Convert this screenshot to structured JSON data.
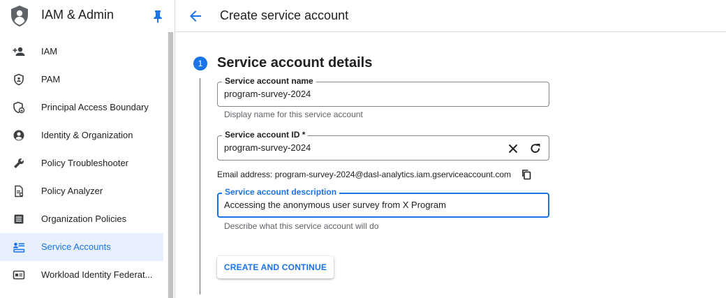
{
  "sidebar": {
    "product_title": "IAM & Admin",
    "items": [
      {
        "label": "IAM",
        "icon": "person-add-icon"
      },
      {
        "label": "PAM",
        "icon": "shield-icon"
      },
      {
        "label": "Principal Access Boundary",
        "icon": "boundary-shield-icon"
      },
      {
        "label": "Identity & Organization",
        "icon": "account-circle-icon"
      },
      {
        "label": "Policy Troubleshooter",
        "icon": "wrench-icon"
      },
      {
        "label": "Policy Analyzer",
        "icon": "policy-document-icon"
      },
      {
        "label": "Organization Policies",
        "icon": "list-document-icon"
      },
      {
        "label": "Service Accounts",
        "icon": "service-account-icon",
        "active": true
      },
      {
        "label": "Workload Identity Federat...",
        "icon": "id-card-icon"
      }
    ]
  },
  "header": {
    "title": "Create service account"
  },
  "step": {
    "number": "1",
    "title": "Service account details"
  },
  "form": {
    "name": {
      "label": "Service account name",
      "value": "program-survey-2024",
      "hint": "Display name for this service account"
    },
    "id": {
      "label": "Service account ID *",
      "value": "program-survey-2024"
    },
    "email": {
      "text": "Email address: program-survey-2024@dasl-analytics.iam.gserviceaccount.com"
    },
    "description": {
      "label": "Service account description",
      "value": "Accessing the anonymous user survey from X Program",
      "hint": "Describe what this service account will do"
    },
    "submit_label": "CREATE AND CONTINUE"
  },
  "colors": {
    "accent": "#1a73e8",
    "active_bg": "#e8f0fe",
    "text": "#202124",
    "muted": "#5f6368"
  }
}
